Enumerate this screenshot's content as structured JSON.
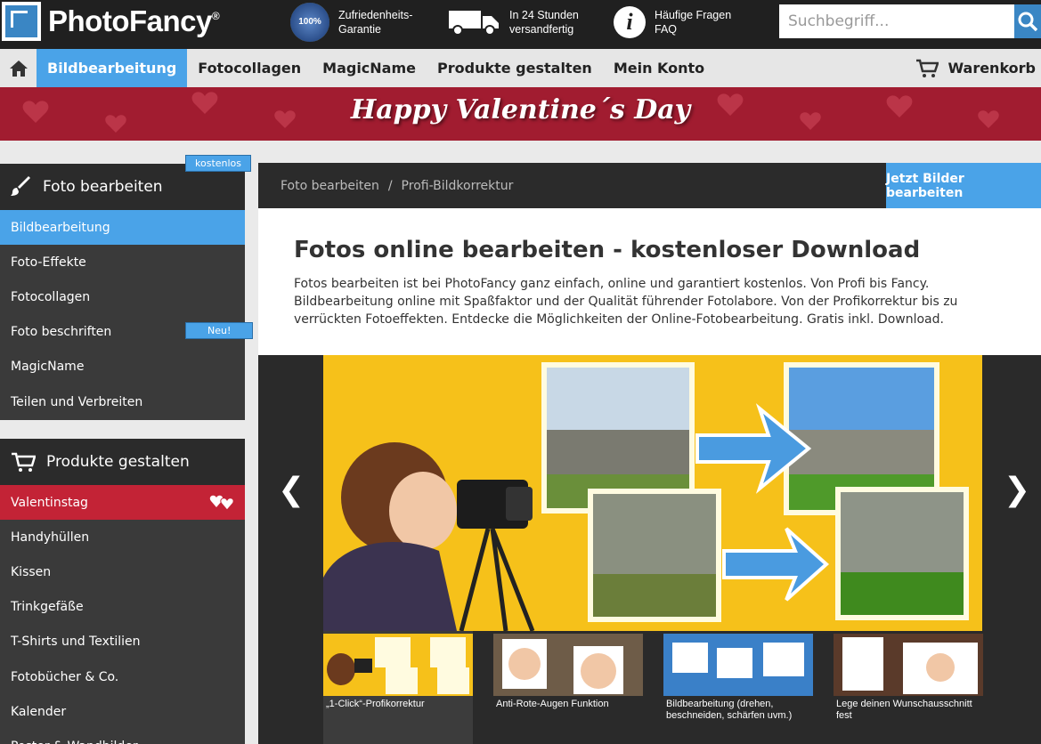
{
  "header": {
    "logo_text": "PhotoFancy",
    "logo_reg": "®",
    "usp": [
      {
        "icon": "seal-icon",
        "line1": "Zufriedenheits-",
        "line2": "Garantie",
        "badge": "100%"
      },
      {
        "icon": "truck-icon",
        "line1": "In 24 Stunden",
        "line2": "versandfertig"
      },
      {
        "icon": "info-icon",
        "line1": "Häufige Fragen",
        "line2": "FAQ"
      }
    ],
    "search_placeholder": "Suchbegriff..."
  },
  "nav": {
    "items": [
      "Bildbearbeitung",
      "Fotocollagen",
      "MagicName",
      "Produkte gestalten",
      "Mein Konto"
    ],
    "active_index": 0,
    "cart_label": "Warenkorb"
  },
  "banner": {
    "text": "Happy Valentine´s Day"
  },
  "sidebar": {
    "section1": {
      "title": "Foto bearbeiten",
      "badge": "kostenlos",
      "items": [
        "Bildbearbeitung",
        "Foto-Effekte",
        "Fotocollagen",
        "Foto beschriften",
        "MagicName",
        "Teilen und Verbreiten"
      ],
      "new_badge": "Neu!"
    },
    "section2": {
      "title": "Produkte gestalten",
      "items": [
        "Valentinstag",
        "Handyhüllen",
        "Kissen",
        "Trinkgefäße",
        "T-Shirts und Textilien",
        "Fotobücher & Co.",
        "Kalender",
        "Poster & Wandbilder"
      ]
    }
  },
  "breadcrumb": {
    "items": [
      "Foto bearbeiten",
      "Profi-Bildkorrektur"
    ],
    "separator": "/"
  },
  "cta_button": "Jetzt Bilder bearbeiten",
  "main": {
    "title": "Fotos online bearbeiten - kostenloser Download",
    "text": "Fotos bearbeiten ist bei PhotoFancy ganz einfach, online und garantiert kostenlos. Von Profi bis Fancy. Bildbearbeitung online mit Spaßfaktor und der Qualität führender Fotolabore. Von der Profikorrektur bis zu verrückten Fotoeffekten. Entdecke die Möglichkeiten der Online-Fotobearbeitung. Gratis inkl. Download."
  },
  "slider": {
    "prev": "❮",
    "next": "❯",
    "thumbs": [
      {
        "caption": "„1-Click“-Profikorrektur"
      },
      {
        "caption": "Anti-Rote-Augen Funktion"
      },
      {
        "caption": "Bildbearbeitung (drehen, beschneiden, schärfen uvm.)"
      },
      {
        "caption": "Lege deinen Wunschausschnitt fest"
      }
    ]
  },
  "colors": {
    "accent": "#4aa3e8",
    "dark": "#2b2b2b",
    "valentine": "#c32336",
    "slide_bg": "#f6c11a"
  }
}
